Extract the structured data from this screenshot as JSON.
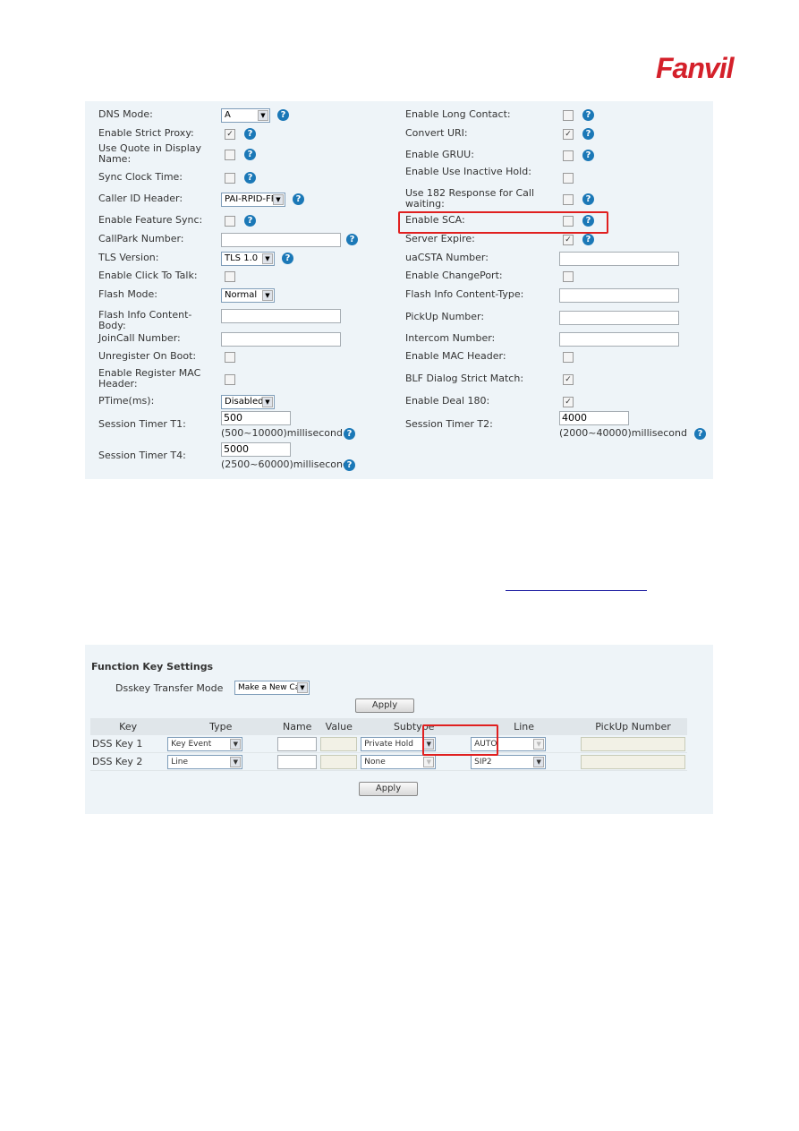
{
  "logo": "Fanvil",
  "sip_settings": {
    "left": [
      {
        "label": "DNS Mode:",
        "type": "select",
        "value": "A",
        "help": true
      },
      {
        "label": "Enable Strict Proxy:",
        "type": "checkbox",
        "checked": true,
        "help": true
      },
      {
        "label": "Use Quote in Display Name:",
        "type": "checkbox",
        "checked": false,
        "help": true
      },
      {
        "label": "Sync Clock Time:",
        "type": "checkbox",
        "checked": false,
        "help": true
      },
      {
        "label": "Caller ID Header:",
        "type": "select",
        "value": "PAI-RPID-FF",
        "help": true
      },
      {
        "label": "Enable Feature Sync:",
        "type": "checkbox",
        "checked": false,
        "help": true
      },
      {
        "label": "CallPark Number:",
        "type": "text",
        "value": "",
        "help": true
      },
      {
        "label": "TLS Version:",
        "type": "select",
        "value": "TLS 1.0",
        "help": true
      },
      {
        "label": "Enable Click To Talk:",
        "type": "checkbox",
        "checked": false,
        "help": false
      },
      {
        "label": "Flash Mode:",
        "type": "select",
        "value": "Normal",
        "help": false
      },
      {
        "label": "Flash Info Content-Body:",
        "type": "text",
        "value": "",
        "help": false
      },
      {
        "label": "JoinCall Number:",
        "type": "text",
        "value": "",
        "help": false
      },
      {
        "label": "Unregister On Boot:",
        "type": "checkbox",
        "checked": false,
        "help": false
      },
      {
        "label": "Enable Register MAC Header:",
        "type": "checkbox",
        "checked": false,
        "help": false
      },
      {
        "label": "PTime(ms):",
        "type": "select",
        "value": "Disabled",
        "help": false
      },
      {
        "label": "Session Timer T1:",
        "type": "timer",
        "value": "500",
        "hint": "(500~10000)millisecond",
        "help": true
      },
      {
        "label": "Session Timer T4:",
        "type": "timer",
        "value": "5000",
        "hint": "(2500~60000)millisecond",
        "help": true
      }
    ],
    "right": [
      {
        "label": "Enable Long Contact:",
        "type": "checkbox",
        "checked": false,
        "help": true
      },
      {
        "label": "Convert URI:",
        "type": "checkbox",
        "checked": true,
        "help": true
      },
      {
        "label": "Enable GRUU:",
        "type": "checkbox",
        "checked": false,
        "help": true
      },
      {
        "label": "Enable Use Inactive Hold:",
        "type": "checkbox",
        "checked": false,
        "help": false
      },
      {
        "label": "Use 182 Response for Call waiting:",
        "type": "checkbox",
        "checked": false,
        "help": true
      },
      {
        "label": "Enable SCA:",
        "type": "checkbox",
        "checked": false,
        "help": true,
        "highlighted": true
      },
      {
        "label": "Server Expire:",
        "type": "checkbox",
        "checked": true,
        "help": true
      },
      {
        "label": "uaCSTA Number:",
        "type": "text",
        "value": "",
        "help": false
      },
      {
        "label": "Enable ChangePort:",
        "type": "checkbox",
        "checked": false,
        "help": false
      },
      {
        "label": "Flash Info Content-Type:",
        "type": "text",
        "value": "",
        "help": false
      },
      {
        "label": "PickUp Number:",
        "type": "text",
        "value": "",
        "help": false
      },
      {
        "label": "Intercom Number:",
        "type": "text",
        "value": "",
        "help": false
      },
      {
        "label": "Enable MAC Header:",
        "type": "checkbox",
        "checked": false,
        "help": false
      },
      {
        "label": "BLF Dialog Strict Match:",
        "type": "checkbox",
        "checked": true,
        "help": false
      },
      {
        "label": "Enable Deal 180:",
        "type": "checkbox",
        "checked": true,
        "help": false
      },
      {
        "label": "Session Timer T2:",
        "type": "timer",
        "value": "4000",
        "hint": "(2000~40000)millisecond",
        "help": true
      }
    ]
  },
  "function_keys": {
    "title": "Function Key Settings",
    "transfer_mode_label": "Dsskey Transfer Mode",
    "transfer_mode_value": "Make a New Call",
    "apply": "Apply",
    "columns": [
      "Key",
      "Type",
      "Name",
      "Value",
      "Subtype",
      "Line",
      "PickUp Number"
    ],
    "rows": [
      {
        "key": "DSS Key 1",
        "type": "Key Event",
        "name": "",
        "value": "",
        "subtype": "Private Hold",
        "subtype_enabled": true,
        "line": "AUTO",
        "line_enabled": false,
        "pickup": ""
      },
      {
        "key": "DSS Key 2",
        "type": "Line",
        "name": "",
        "value": "",
        "subtype": "None",
        "subtype_enabled": false,
        "line": "SIP2",
        "line_enabled": true,
        "pickup": ""
      }
    ]
  },
  "accent_colors": {
    "highlight": "#e02020",
    "help": "#1b78b7",
    "logo": "#d4202a"
  }
}
